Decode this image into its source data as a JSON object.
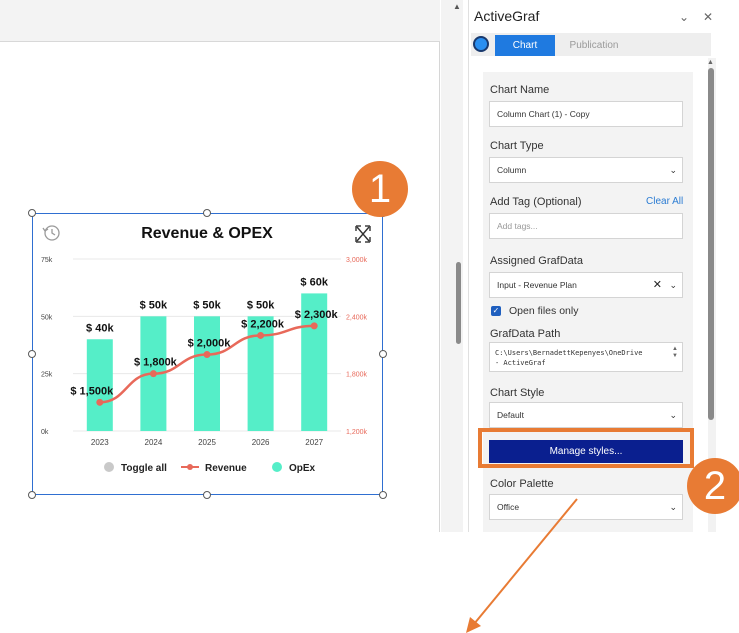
{
  "panel": {
    "title": "ActiveGraf",
    "controls": {
      "collapse": "⌄",
      "close": "✕"
    },
    "tabs": [
      {
        "label": "Chart",
        "active": true
      },
      {
        "label": "Publication",
        "active": false
      }
    ],
    "chart_name": {
      "label": "Chart Name",
      "value": "Column Chart (1) - Copy"
    },
    "chart_type": {
      "label": "Chart Type",
      "value": "Column"
    },
    "tags": {
      "label": "Add Tag (Optional)",
      "clear_all": "Clear All",
      "placeholder": "Add tags..."
    },
    "grafdata": {
      "label": "Assigned GrafData",
      "value": "Input - Revenue Plan"
    },
    "open_files_only": {
      "label": "Open files only",
      "checked": true
    },
    "grafdata_path": {
      "label": "GrafData Path",
      "value": "C:\\Users\\BernadettKepenyes\\OneDrive\n- ActiveGraf"
    },
    "chart_style": {
      "label": "Chart Style",
      "value": "Default"
    },
    "manage_styles": "Manage styles...",
    "color_palette": {
      "label": "Color Palette",
      "value": "Office"
    }
  },
  "callouts": {
    "one": "1",
    "two": "2",
    "color": "#e87b34"
  },
  "chart_data": {
    "type": "bar",
    "title": "Revenue & OPEX",
    "categories": [
      "2023",
      "2024",
      "2025",
      "2026",
      "2027"
    ],
    "y_left": {
      "ticks": [
        "0k",
        "25k",
        "50k",
        "75k"
      ],
      "min": 0,
      "max": 75
    },
    "y_right": {
      "ticks": [
        "1,200k",
        "1,800k",
        "2,400k",
        "3,000k"
      ],
      "min": 1200,
      "max": 3000
    },
    "series": [
      {
        "name": "OpEx",
        "kind": "bar",
        "axis": "left",
        "color": "#55eec8",
        "values": [
          40,
          50,
          50,
          50,
          60
        ],
        "labels": [
          "$ 40k",
          "$ 50k",
          "$ 50k",
          "$ 50k",
          "$ 60k"
        ]
      },
      {
        "name": "Revenue",
        "kind": "line",
        "axis": "right",
        "color": "#e8695a",
        "values": [
          1500,
          1800,
          2000,
          2200,
          2300
        ],
        "labels": [
          "$ 1,500k",
          "$ 1,800k",
          "$ 2,000k",
          "$ 2,200k",
          "$ 2,300k"
        ]
      }
    ],
    "legend": {
      "toggle_all": "Toggle all",
      "position": "bottom"
    },
    "colors": {
      "axis_right": "#e8695a",
      "grid": "#e8e8e8"
    }
  }
}
